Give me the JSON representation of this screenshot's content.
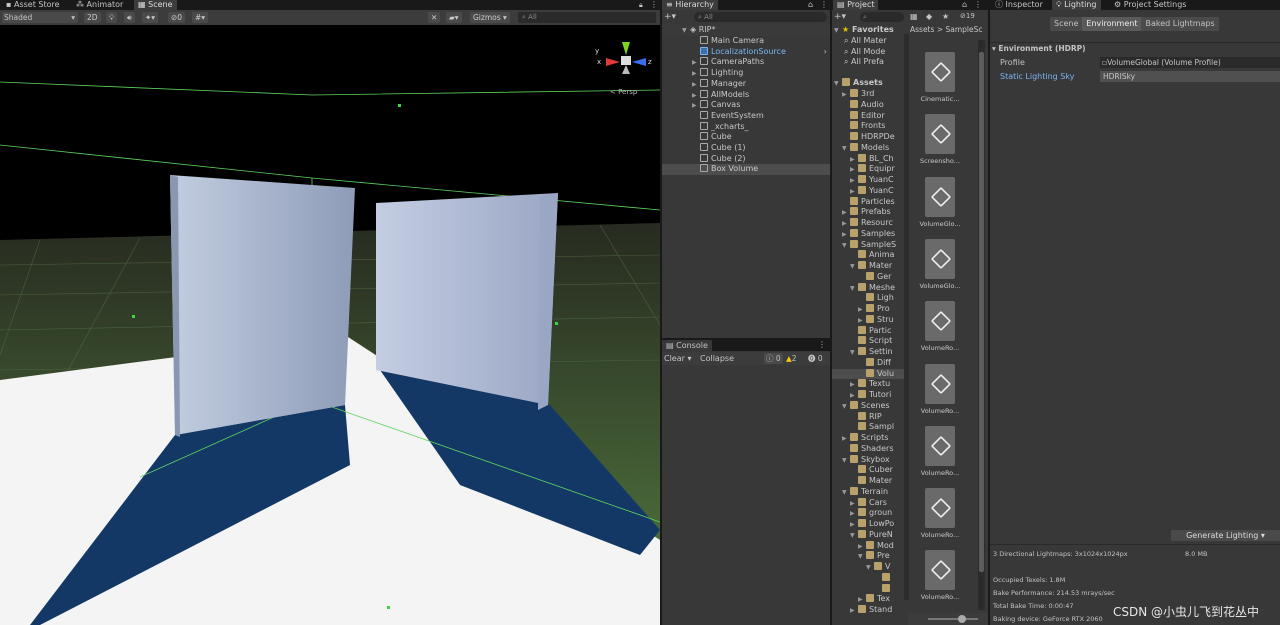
{
  "top_tabs": {
    "asset_store": "Asset Store",
    "animator": "Animator",
    "scene": "Scene",
    "hierarchy": "Hierarchy",
    "project": "Project",
    "inspector": "Inspector",
    "lighting": "Lighting",
    "project_settings": "Project Settings"
  },
  "scene_toolbar": {
    "shading_mode": "Shaded",
    "mode_2d": "2D",
    "hidden_count": "0",
    "gizmos": "Gizmos",
    "search_placeholder": "All",
    "persp_label": "< Persp",
    "axis_x": "x",
    "axis_y": "y",
    "axis_z": "z"
  },
  "hierarchy": {
    "search_placeholder": "All",
    "root": "RIP*",
    "items": [
      "Main Camera",
      "LocalizationSource",
      "CameraPaths",
      "Lighting",
      "Manager",
      "AllModels",
      "Canvas",
      "EventSystem",
      "_xcharts_",
      "Cube",
      "Cube (1)",
      "Cube (2)",
      "Box Volume"
    ]
  },
  "console": {
    "title": "Console",
    "clear": "Clear",
    "collapse": "Collapse",
    "log_count": "0",
    "warn_count": "2",
    "error_count": "0"
  },
  "project": {
    "hidden_count": "19",
    "favorites": "Favorites",
    "favorite_items": [
      "All Mater",
      "All Mode",
      "All Prefa"
    ],
    "assets": "Assets",
    "breadcrumb": "Assets > SampleSc",
    "tree": [
      "3rd",
      "Audio",
      "Editor",
      "Fronts",
      "HDRPDe",
      "Models",
      "BL_Ch",
      "Equipr",
      "YuanC",
      "YuanC",
      "Particles",
      "Prefabs",
      "Resourc",
      "Samples",
      "SampleS",
      "Anima",
      "Mater",
      "Ger",
      "Meshe",
      "Ligh",
      "Pro",
      "Stru",
      "Partic",
      "Script",
      "Settin",
      "Diff",
      "Volu",
      "Textu",
      "Tutori",
      "Scenes",
      "RIP",
      "Sampl",
      "Scripts",
      "Shaders",
      "Skybox",
      "Cuber",
      "Mater",
      "Terrain",
      "Cars",
      "groun",
      "LowPo",
      "PureN",
      "Mod",
      "Pre",
      "V",
      "",
      "",
      "Tex",
      "Stand"
    ],
    "asset_labels": [
      "Cinematic...",
      "Screensho...",
      "VolumeGlo...",
      "VolumeGlo...",
      "VolumeRo...",
      "VolumeRo...",
      "VolumeRo...",
      "VolumeRo...",
      "VolumeRo..."
    ]
  },
  "lighting": {
    "tab_scene": "Scene",
    "tab_environment": "Environment",
    "tab_baked": "Baked Lightmaps",
    "section": "Environment (HDRP)",
    "profile_label": "Profile",
    "profile_value": "VolumeGlobal (Volume Profile)",
    "sky_label": "Static Lighting Sky",
    "sky_value": "HDRISky",
    "generate": "Generate Lighting",
    "stats": {
      "lightmaps": "3 Directional Lightmaps: 3x1024x1024px",
      "size": "8.0 MB",
      "occupied": "Occupied Texels: 1.8M",
      "performance": "Bake Performance: 214.53 mrays/sec",
      "time": "Total Bake Time: 0:00:47",
      "device": "Baking device: GeForce RTX 2060"
    }
  },
  "watermark": "CSDN @小虫儿飞到花丛中",
  "colors": {
    "accent_blue": "#7ab4f5",
    "panel": "#383838",
    "dark": "#191919",
    "shadow": "#143866"
  }
}
